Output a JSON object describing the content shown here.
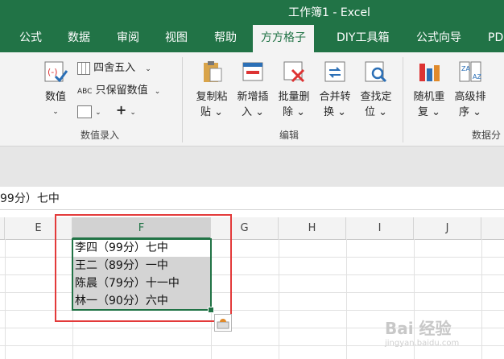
{
  "window": {
    "title": "工作簿1  -  Excel"
  },
  "tabs": [
    {
      "label": "公式"
    },
    {
      "label": "数据"
    },
    {
      "label": "审阅"
    },
    {
      "label": "视图"
    },
    {
      "label": "帮助"
    },
    {
      "label": "方方格子",
      "active": true
    },
    {
      "label": "DIY工具箱"
    },
    {
      "label": "公式向导"
    },
    {
      "label": "PD"
    }
  ],
  "ribbon": {
    "value_entry": {
      "numeric_label": "数值",
      "round_label": "四舍五入",
      "keep_values_label": "只保留数值",
      "plus_label": "+",
      "group_label": "数值录入"
    },
    "edit": {
      "copy_paste": [
        "复制粘",
        "贴"
      ],
      "insert": [
        "新增插",
        "入"
      ],
      "batch_delete": [
        "批量删",
        "除"
      ],
      "merge_convert": [
        "合并转",
        "换"
      ],
      "find_locate": [
        "查找定",
        "位"
      ],
      "group_label": "编辑"
    },
    "data_analysis": {
      "random_repeat": [
        "随机重",
        "复"
      ],
      "advanced_sort": [
        "高级排",
        "序"
      ],
      "group_label": "数据分"
    }
  },
  "formula_bar": {
    "value": "99分）七中"
  },
  "columns": [
    "E",
    "F",
    "G",
    "H",
    "I",
    "J"
  ],
  "selected_column": "F",
  "cells": [
    "李四（99分）七中",
    "王二（89分）一中",
    "陈晨（79分）十一中",
    "林一（90分）六中"
  ],
  "colors": {
    "excel_green": "#217346",
    "annotation_red": "#e33a3a",
    "selection_gray": "#d4d4d4"
  },
  "watermark": {
    "line1": "Bai 经验",
    "line2": "jingyan.baidu.com"
  }
}
